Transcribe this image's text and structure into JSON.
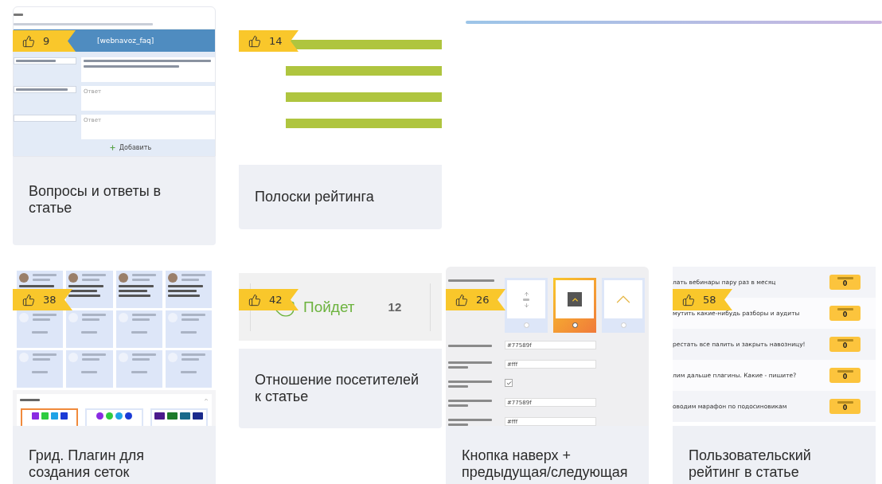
{
  "rows": [
    [
      {
        "likes": "9",
        "title": "Вопросы и ответы в статье",
        "preview": {
          "kind": "faq",
          "shortcode": "[webnavoz_faq]",
          "add_label": "Добавить",
          "items": [
            {
              "kind": "answered"
            },
            {
              "kind": "asked",
              "placeholder": "Ответ"
            },
            {
              "kind": "empty",
              "placeholder": "Ответ"
            }
          ]
        }
      },
      {
        "likes": "14",
        "title": "Полоски рейтинга",
        "preview": {
          "kind": "bars"
        }
      },
      {
        "preview": {
          "kind": "gradient-line"
        }
      }
    ],
    [
      {
        "likes": "38",
        "title": "Грид. Плагин для создания сеток",
        "preview": {
          "kind": "grid",
          "tiles": [
            {
              "avatar": true
            },
            {
              "avatar": true
            },
            {
              "avatar": true
            },
            {
              "avatar": true
            },
            {
              "avatar": false
            },
            {
              "avatar": false
            },
            {
              "avatar": false
            },
            {
              "avatar": false
            },
            {
              "avatar": false
            },
            {
              "avatar": false
            },
            {
              "avatar": false
            },
            {
              "avatar": false
            }
          ],
          "styles": [
            {
              "kind": "squares",
              "selected": true
            },
            {
              "kind": "circles",
              "selected": false
            },
            {
              "kind": "tiles",
              "selected": false
            }
          ]
        }
      },
      {
        "likes": "42",
        "title": "Отношение посетителей к статье",
        "preview": {
          "kind": "attitude",
          "label": "Пойдет",
          "count": "12"
        }
      },
      {
        "likes": "26",
        "title": "Кнопка наверх + предыдущая/следующая",
        "preview": {
          "kind": "scroll-button",
          "templates": [
            {
              "kind": "arrows",
              "selected": false
            },
            {
              "kind": "square",
              "selected": true
            },
            {
              "kind": "chevron",
              "selected": false
            }
          ],
          "fields": [
            {
              "kind": "text",
              "value": "#77589f"
            },
            {
              "kind": "text",
              "value": "#fff"
            },
            {
              "kind": "checkbox",
              "checked": true
            },
            {
              "kind": "text",
              "value": "#77589f"
            },
            {
              "kind": "text",
              "value": "#fff"
            }
          ]
        }
      },
      {
        "likes": "58",
        "title": "Пользовательский рейтинг в статье",
        "preview": {
          "kind": "user-rating",
          "items": [
            {
              "text": "лать вебинары пару раз в месяц",
              "score": "0"
            },
            {
              "text": "мутить какие-нибудь разборы и аудиты",
              "score": "0"
            },
            {
              "text": "рестать все палить и закрыть навозницу!",
              "score": "0"
            },
            {
              "text": "лим дальше плагины. Какие - пишите?",
              "score": "0"
            },
            {
              "text": "оводим марафон по подосиновикам",
              "score": "0"
            }
          ]
        }
      }
    ]
  ]
}
